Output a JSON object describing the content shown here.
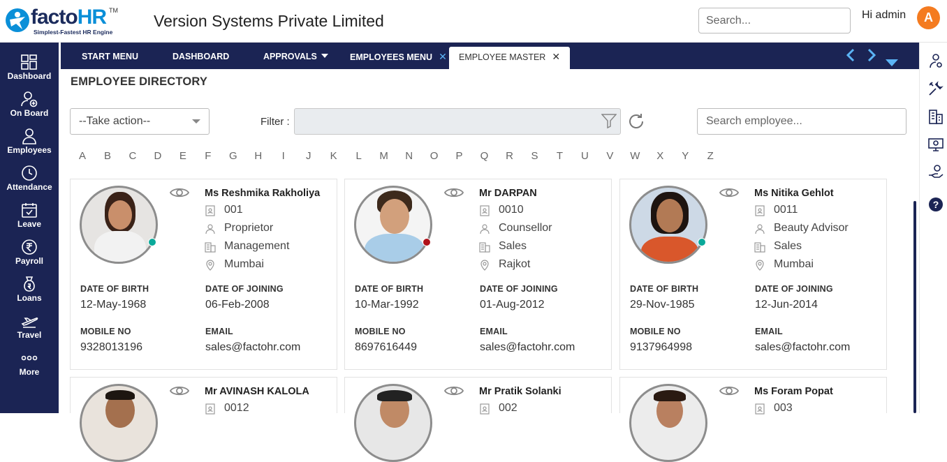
{
  "header": {
    "logo_text_main": "facto",
    "logo_text_accent": "HR",
    "logo_tm": "TM",
    "logo_tagline": "Simplest-Fastest HR Engine",
    "company": "Version Systems Private Limited",
    "search_placeholder": "Search...",
    "greeting": "Hi admin",
    "avatar_initial": "A",
    "avatar_color": "#f47b20"
  },
  "sidebar": {
    "items": [
      {
        "label": "Dashboard",
        "icon": "dashboard-icon"
      },
      {
        "label": "On Board",
        "icon": "onboard-icon"
      },
      {
        "label": "Employees",
        "icon": "employees-icon"
      },
      {
        "label": "Attendance",
        "icon": "clock-icon"
      },
      {
        "label": "Leave",
        "icon": "calendar-icon"
      },
      {
        "label": "Payroll",
        "icon": "rupee-icon"
      },
      {
        "label": "Loans",
        "icon": "money-bag-icon"
      },
      {
        "label": "Travel",
        "icon": "plane-icon"
      },
      {
        "label": "More",
        "icon": "more-dots-icon"
      }
    ]
  },
  "tabs": [
    {
      "label": "START MENU"
    },
    {
      "label": "DASHBOARD"
    },
    {
      "label": "APPROVALS"
    },
    {
      "label": "EMPLOYEES MENU"
    },
    {
      "label": "EMPLOYEE MASTER"
    }
  ],
  "page": {
    "title": "EMPLOYEE DIRECTORY",
    "action_select": "--Take action--",
    "filter_label": "Filter :",
    "employee_search_placeholder": "Search employee..."
  },
  "alphabet": [
    "A",
    "B",
    "C",
    "D",
    "E",
    "F",
    "G",
    "H",
    "I",
    "J",
    "K",
    "L",
    "M",
    "N",
    "O",
    "P",
    "Q",
    "R",
    "S",
    "T",
    "U",
    "V",
    "W",
    "X",
    "Y",
    "Z"
  ],
  "labels": {
    "dob": "DATE OF BIRTH",
    "doj": "DATE OF JOINING",
    "mobile": "MOBILE NO",
    "email": "EMAIL"
  },
  "employees": [
    {
      "name": "Ms Reshmika Rakholiya",
      "code": "001",
      "designation": "Proprietor",
      "department": "Management",
      "location": "Mumbai",
      "dob": "12-May-1968",
      "doj": "06-Feb-2008",
      "mobile": "9328013196",
      "email": "sales@factohr.com",
      "status_color": "#0aa99a"
    },
    {
      "name": "Mr DARPAN",
      "code": "0010",
      "designation": "Counsellor",
      "department": "Sales",
      "location": "Rajkot",
      "dob": "10-Mar-1992",
      "doj": "01-Aug-2012",
      "mobile": "8697616449",
      "email": "sales@factohr.com",
      "status_color": "#b0121b"
    },
    {
      "name": "Ms Nitika Gehlot",
      "code": "0011",
      "designation": "Beauty Advisor",
      "department": "Sales",
      "location": "Mumbai",
      "dob": "29-Nov-1985",
      "doj": "12-Jun-2014",
      "mobile": "9137964998",
      "email": "sales@factohr.com",
      "status_color": "#0aa99a"
    },
    {
      "name": "Mr AVINASH KALOLA",
      "code": "0012"
    },
    {
      "name": "Mr Pratik Solanki",
      "code": "002"
    },
    {
      "name": "Ms Foram Popat",
      "code": "003"
    }
  ],
  "colors": {
    "nav_bg": "#1b2454",
    "accent_blue": "#5bb4f5"
  }
}
